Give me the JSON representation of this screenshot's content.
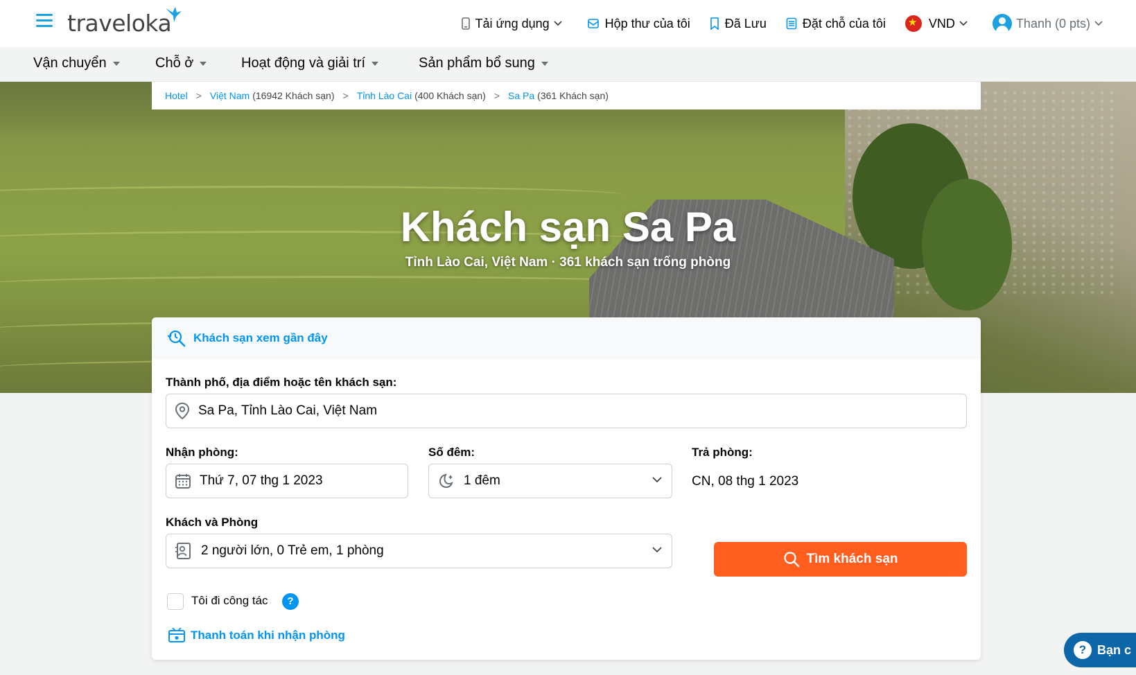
{
  "header": {
    "logo_text": "traveloka",
    "nav": {
      "app": "Tải ứng dụng",
      "inbox": "Hộp thư của tôi",
      "saved": "Đã Lưu",
      "bookings": "Đặt chỗ của tôi",
      "currency": "VND",
      "user": "Thanh (0 pts)"
    }
  },
  "menu": {
    "items": [
      "Vận chuyển",
      "Chỗ ở",
      "Hoạt động và giải trí",
      "Sản phẩm bổ sung"
    ]
  },
  "breadcrumb": {
    "items": [
      {
        "label": "Hotel",
        "count": ""
      },
      {
        "label": "Việt Nam",
        "count": "(16942 Khách sạn)"
      },
      {
        "label": "Tỉnh Lào Cai",
        "count": "(400 Khách sạn)"
      },
      {
        "label": "Sa Pa",
        "count": "(361 Khách sạn)"
      }
    ],
    "separator": ">"
  },
  "hero": {
    "title": "Khách sạn Sa Pa",
    "subtitle": "Tỉnh Lào Cai, Việt Nam · 361 khách sạn trống phòng"
  },
  "search": {
    "recent_label": "Khách sạn xem gần đây",
    "destination_label": "Thành phố, địa điểm hoặc tên khách sạn:",
    "destination_value": "Sa Pa, Tỉnh Lào Cai, Việt Nam",
    "checkin_label": "Nhận phòng:",
    "checkin_value": "Thứ 7, 07 thg 1 2023",
    "nights_label": "Số đêm:",
    "nights_value": "1 đêm",
    "checkout_label": "Trả phòng:",
    "checkout_value": "CN, 08 thg 1 2023",
    "guests_label": "Khách và Phòng",
    "guests_value": "2 người lớn, 0 Trẻ em, 1 phòng",
    "search_button": "Tìm khách sạn",
    "business_trip_label": "Tôi đi công tác",
    "help_mark": "?",
    "pay_at_hotel": "Thanh toán khi nhận phòng"
  },
  "floating_help": {
    "icon": "?",
    "label": "Bạn c"
  },
  "colors": {
    "brand_blue": "#0194f3",
    "accent_orange": "#ff5e1f"
  }
}
